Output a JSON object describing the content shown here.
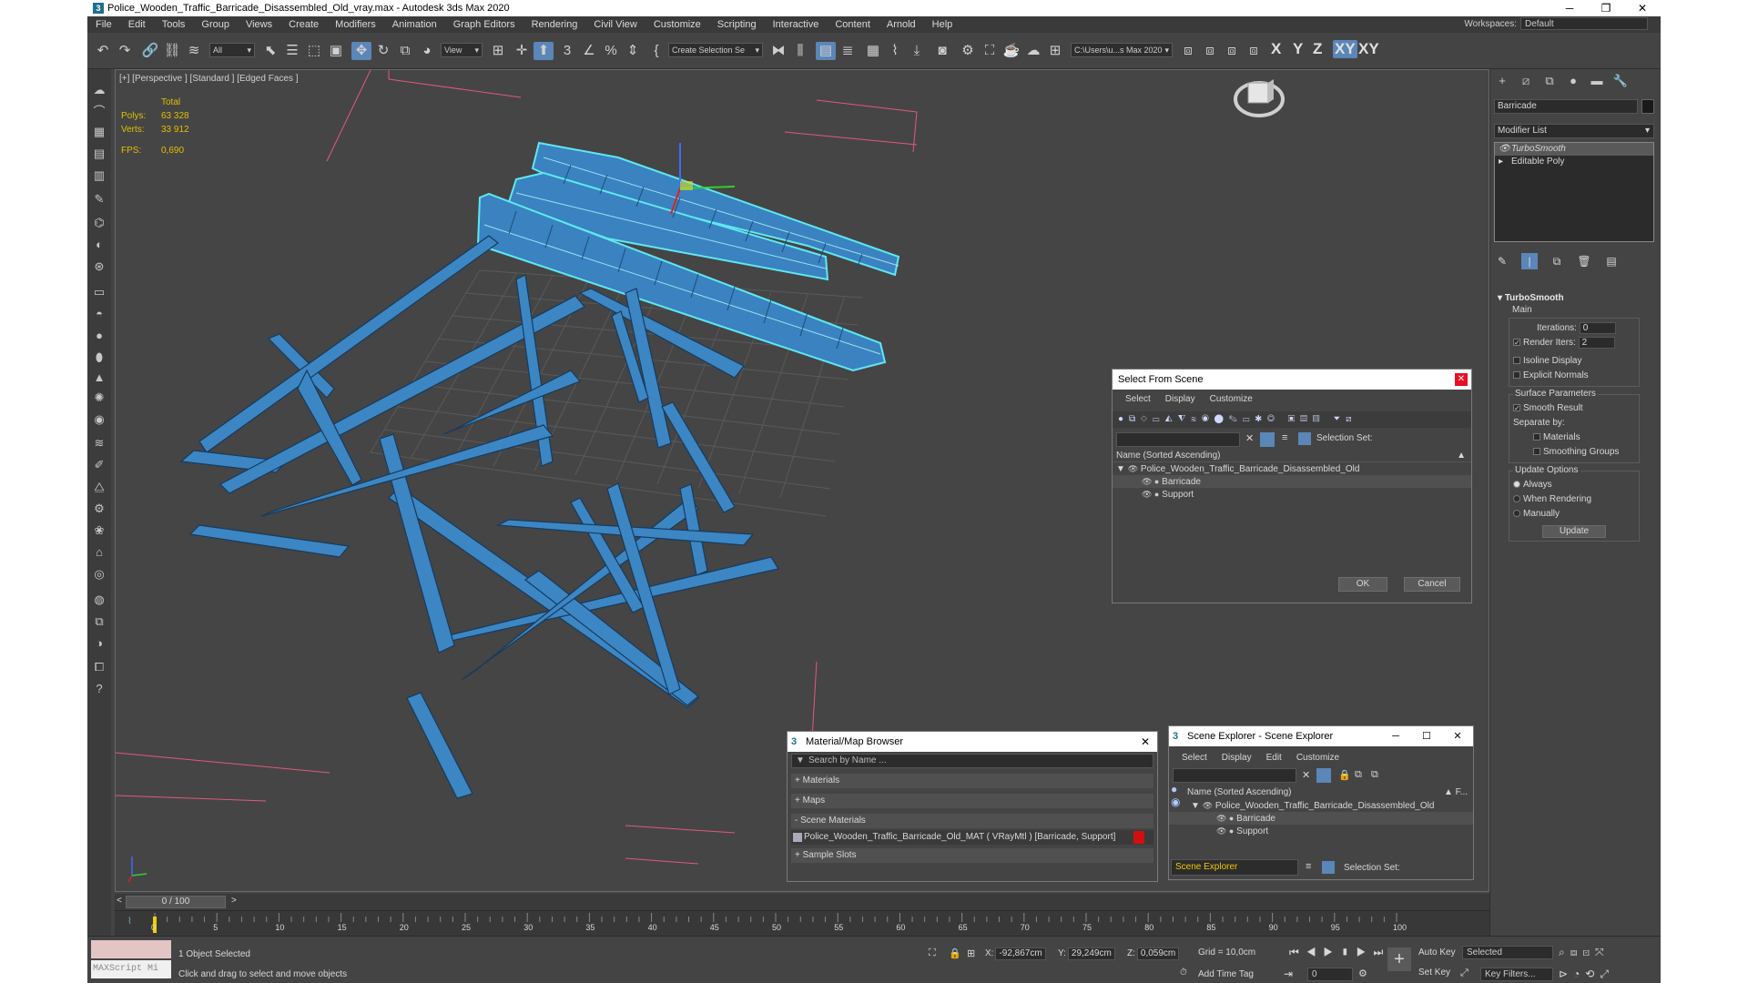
{
  "window": {
    "title": "Police_Wooden_Traffic_Barricade_Disassembled_Old_vray.max - Autodesk 3ds Max 2020",
    "minimize": "─",
    "maximize": "❐",
    "close": "✕"
  },
  "menu": [
    "File",
    "Edit",
    "Tools",
    "Group",
    "Views",
    "Create",
    "Modifiers",
    "Animation",
    "Graph Editors",
    "Rendering",
    "Civil View",
    "Customize",
    "Scripting",
    "Interactive",
    "Content",
    "Arnold",
    "Help"
  ],
  "workspace": {
    "label": "Workspaces:",
    "value": "Default"
  },
  "toolbar": {
    "filter": "All",
    "coord_system": "View",
    "named_selection": "Create Selection Se",
    "path": "C:\\Users\\u...s Max 2020",
    "axes": [
      "X",
      "Y",
      "Z",
      "XY",
      "XY"
    ]
  },
  "viewport": {
    "label": "[+] [Perspective ] [Standard ] [Edged Faces ]",
    "stats": {
      "header": "Total",
      "polys_label": "Polys:",
      "polys": "63 328",
      "verts_label": "Verts:",
      "verts": "33 912",
      "fps_label": "FPS:",
      "fps": "0,690"
    }
  },
  "select_from_scene": {
    "title": "Select From Scene",
    "menu": [
      "Select",
      "Display",
      "Customize"
    ],
    "selection_set_label": "Selection Set:",
    "column": "Name (Sorted Ascending)",
    "root": "Police_Wooden_Traffic_Barricade_Disassembled_Old",
    "children": [
      "Barricade",
      "Support"
    ],
    "ok": "OK",
    "cancel": "Cancel"
  },
  "material_browser": {
    "title": "Material/Map Browser",
    "search_placeholder": "Search by Name ...",
    "sections": [
      "+ Materials",
      "+ Maps",
      "- Scene Materials"
    ],
    "material_item": "Police_Wooden_Traffic_Barricade_Old_MAT ( VRayMtl ) [Barricade, Support]",
    "sample_slots": "+ Sample Slots"
  },
  "scene_explorer": {
    "title": "Scene Explorer - Scene Explorer",
    "menu": [
      "Select",
      "Display",
      "Edit",
      "Customize"
    ],
    "column": "Name (Sorted Ascending)",
    "column_right": "▲ F...",
    "root": "Police_Wooden_Traffic_Barricade_Disassembled_Old",
    "children": [
      "Barricade",
      "Support"
    ],
    "explorer_name": "Scene Explorer",
    "selection_set_label": "Selection Set:"
  },
  "command_panel": {
    "object_name": "Barricade",
    "modifier_list": "Modifier List",
    "stack": [
      "TurboSmooth",
      "Editable Poly"
    ],
    "rollout_title": "TurboSmooth",
    "main_label": "Main",
    "iterations_label": "Iterations:",
    "iterations": "0",
    "render_iters_label": "Render Iters:",
    "render_iters": "2",
    "isoline": "Isoline Display",
    "explicit_normals": "Explicit Normals",
    "surface_params": "Surface Parameters",
    "smooth_result": "Smooth Result",
    "separate_by": "Separate by:",
    "materials": "Materials",
    "smoothing_groups": "Smoothing Groups",
    "update_options": "Update Options",
    "always": "Always",
    "when_rendering": "When Rendering",
    "manually": "Manually",
    "update_btn": "Update"
  },
  "timeline": {
    "frame": "0 / 100",
    "ticks": [
      "0",
      "5",
      "10",
      "15",
      "20",
      "25",
      "30",
      "35",
      "40",
      "45",
      "50",
      "55",
      "60",
      "65",
      "70",
      "75",
      "80",
      "85",
      "90",
      "95",
      "100"
    ]
  },
  "status": {
    "maxscript": "MAXScript Mi",
    "selected": "1 Object Selected",
    "prompt": "Click and drag to select and move objects",
    "x_label": "X:",
    "x": "-92,867cm",
    "y_label": "Y:",
    "y": "29,249cm",
    "z_label": "Z:",
    "z": "0,059cm",
    "grid": "Grid = 10,0cm",
    "add_time_tag": "Add Time Tag",
    "auto_key": "Auto Key",
    "set_key": "Set Key",
    "key_mode": "Selected",
    "frame_field": "0",
    "key_filters": "Key Filters..."
  }
}
